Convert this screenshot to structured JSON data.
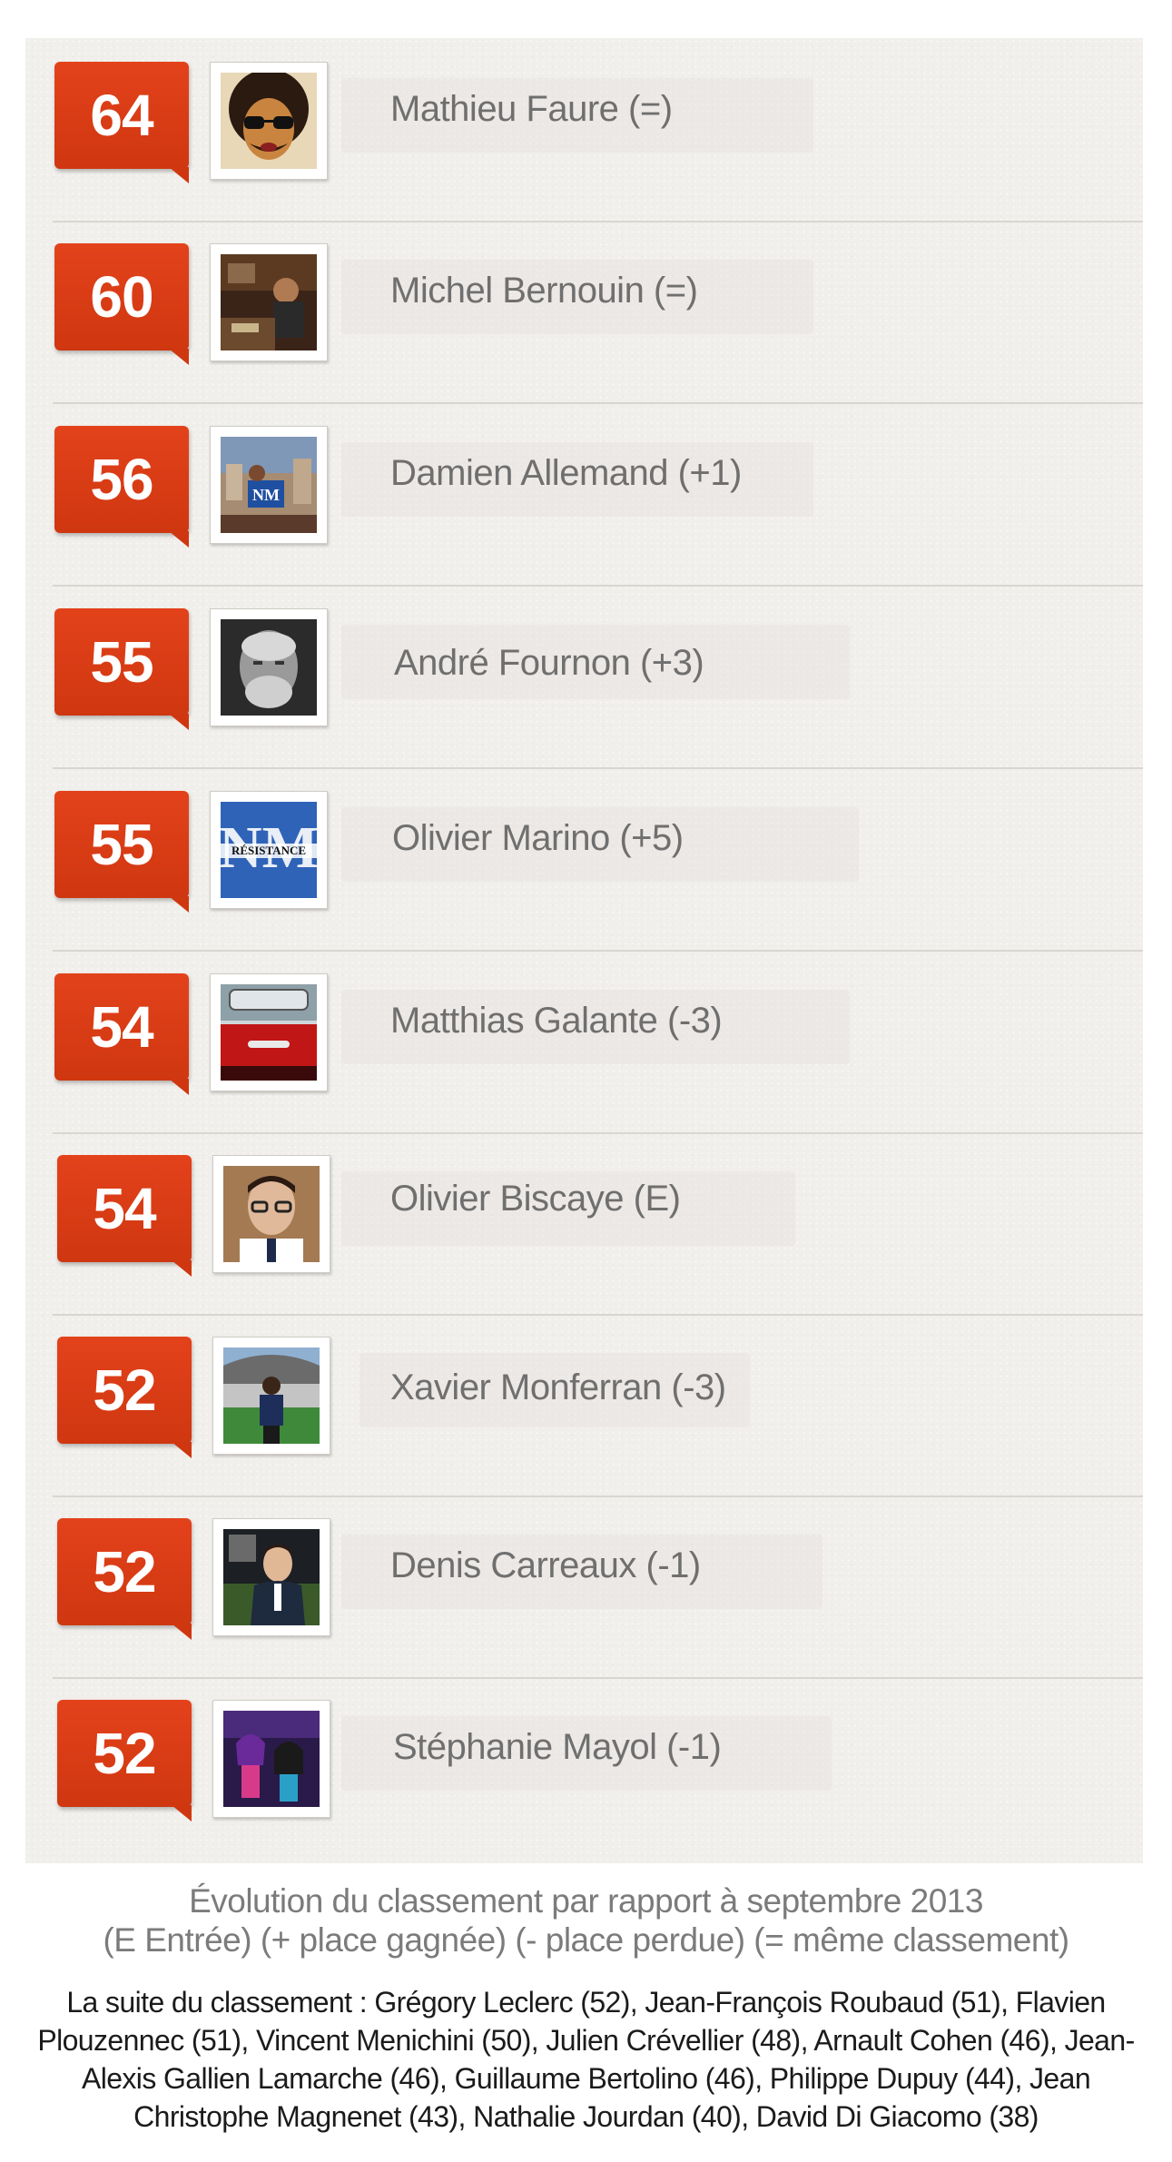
{
  "colors": {
    "badge": "#d83a12",
    "name_text": "#6f6f6f",
    "panel": "#f1efeb"
  },
  "rows": [
    {
      "score": "64",
      "name": "Mathieu Faure (=)",
      "avatar": "afro-sunglasses-avatar"
    },
    {
      "score": "60",
      "name": "Michel Bernouin  (=)",
      "avatar": "person-at-desk-photo"
    },
    {
      "score": "56",
      "name": "Damien Allemand (+1)",
      "avatar": "city-nm-photo"
    },
    {
      "score": "55",
      "name": "André Fournon (+3)",
      "avatar": "bearded-man-bw-photo"
    },
    {
      "score": "55",
      "name": "Olivier Marino (+5)",
      "avatar": "nm-resistance-logo"
    },
    {
      "score": "54",
      "name": "Matthias Galante  (-3)",
      "avatar": "red-car-photo"
    },
    {
      "score": "54",
      "name": "Olivier Biscaye  (E)",
      "avatar": "man-glasses-photo"
    },
    {
      "score": "52",
      "name": "Xavier Monferran (-3)",
      "avatar": "stadium-photo"
    },
    {
      "score": "52",
      "name": "Denis Carreaux  (-1)",
      "avatar": "man-suit-photo"
    },
    {
      "score": "52",
      "name": "Stéphanie Mayol (-1)",
      "avatar": "anime-poster"
    }
  ],
  "avatar_logo_text": {
    "nm": "NM",
    "resistance": "RÉSISTANCE"
  },
  "footer": {
    "title": "Évolution du classement par rapport à septembre 2013",
    "legend": "(E Entrée)  (+ place gagnée)  (- place perdue)  (= même classement)",
    "list": "La suite du classement : Grégory Leclerc (52), Jean-François Roubaud (51), Flavien Plouzennec (51), Vincent Menichini (50), Julien Crévellier (48), Arnault Cohen (46), Jean-Alexis Gallien Lamarche (46), Guillaume Bertolino (46), Philippe Dupuy (44), Jean Christophe Magnenet (43), Nathalie Jourdan (40), David Di Giacomo (38)"
  }
}
